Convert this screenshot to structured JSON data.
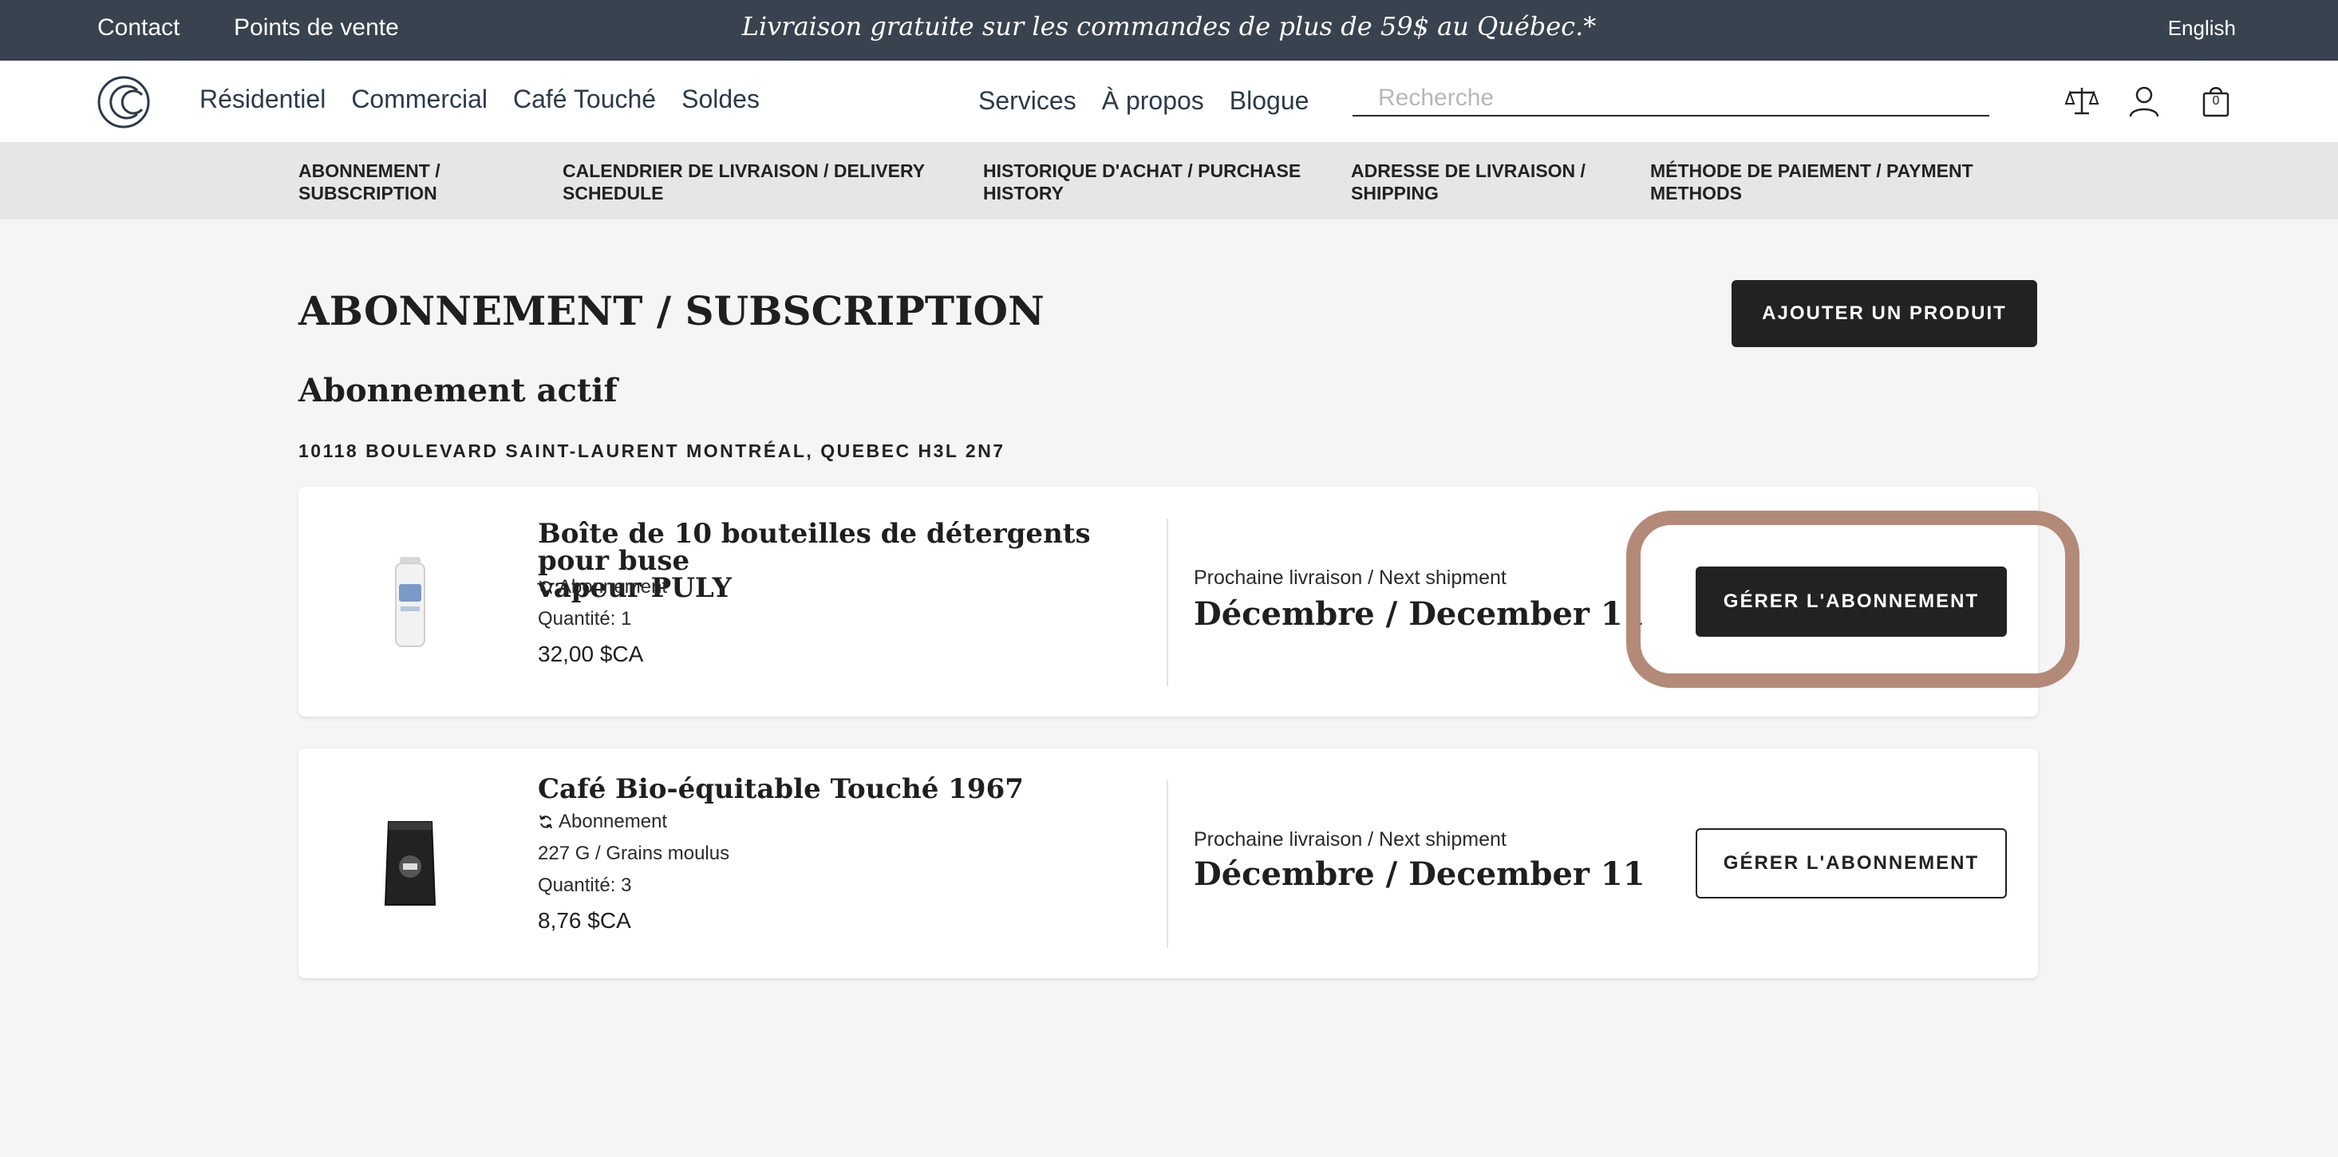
{
  "topbar": {
    "contact": "Contact",
    "stores": "Points de vente",
    "promo": "Livraison gratuite sur les commandes de plus de 59$ au Québec.*",
    "language": "English"
  },
  "header": {
    "nav_left": [
      "Résidentiel",
      "Commercial",
      "Café Touché",
      "Soldes"
    ],
    "nav_mid": [
      "Services",
      "À propos",
      "Blogue"
    ],
    "search_placeholder": "Recherche",
    "cart_count": "0",
    "icons": [
      "logo-icon",
      "compare-scale-icon",
      "user-icon",
      "cart-bag-icon"
    ]
  },
  "subnav": {
    "items": [
      {
        "line1": "ABONNEMENT /",
        "line2": "SUBSCRIPTION"
      },
      {
        "line1": "CALENDRIER DE LIVRAISON / DELIVERY",
        "line2": "SCHEDULE"
      },
      {
        "line1": "HISTORIQUE D'ACHAT / PURCHASE",
        "line2": "HISTORY"
      },
      {
        "line1": "ADRESSE DE LIVRAISON /",
        "line2": "SHIPPING"
      },
      {
        "line1": "MÉTHODE DE PAIEMENT / PAYMENT",
        "line2": "METHODS"
      }
    ]
  },
  "page": {
    "title": "ABONNEMENT / SUBSCRIPTION",
    "add_product": "AJOUTER UN PRODUIT",
    "section_title": "Abonnement actif",
    "address": "10118 BOULEVARD SAINT-LAURENT MONTRÉAL, QUEBEC H3L 2N7"
  },
  "subscriptions": [
    {
      "name_line1": "Boîte de 10 bouteilles de détergents pour buse",
      "name_line2": "vapeur PULY",
      "type": "Abonnement",
      "quantity": "Quantité: 1",
      "price": "32,00 $CA",
      "ship_label": "Prochaine livraison / Next shipment",
      "ship_date": "Décembre / December 11",
      "manage": "GÉRER L'ABONNEMENT"
    },
    {
      "name": "Café Bio-équitable Touché 1967",
      "type": "Abonnement",
      "variant": "227 G / Grains moulus",
      "quantity": "Quantité: 3",
      "price": "8,76 $CA",
      "ship_label": "Prochaine livraison / Next shipment",
      "ship_date": "Décembre / December 11",
      "manage": "GÉRER L'ABONNEMENT"
    }
  ],
  "colors": {
    "topbar": "#39424f",
    "button_dark": "#222222",
    "highlight": "#b38a78",
    "page_bg": "#f5f5f5"
  }
}
